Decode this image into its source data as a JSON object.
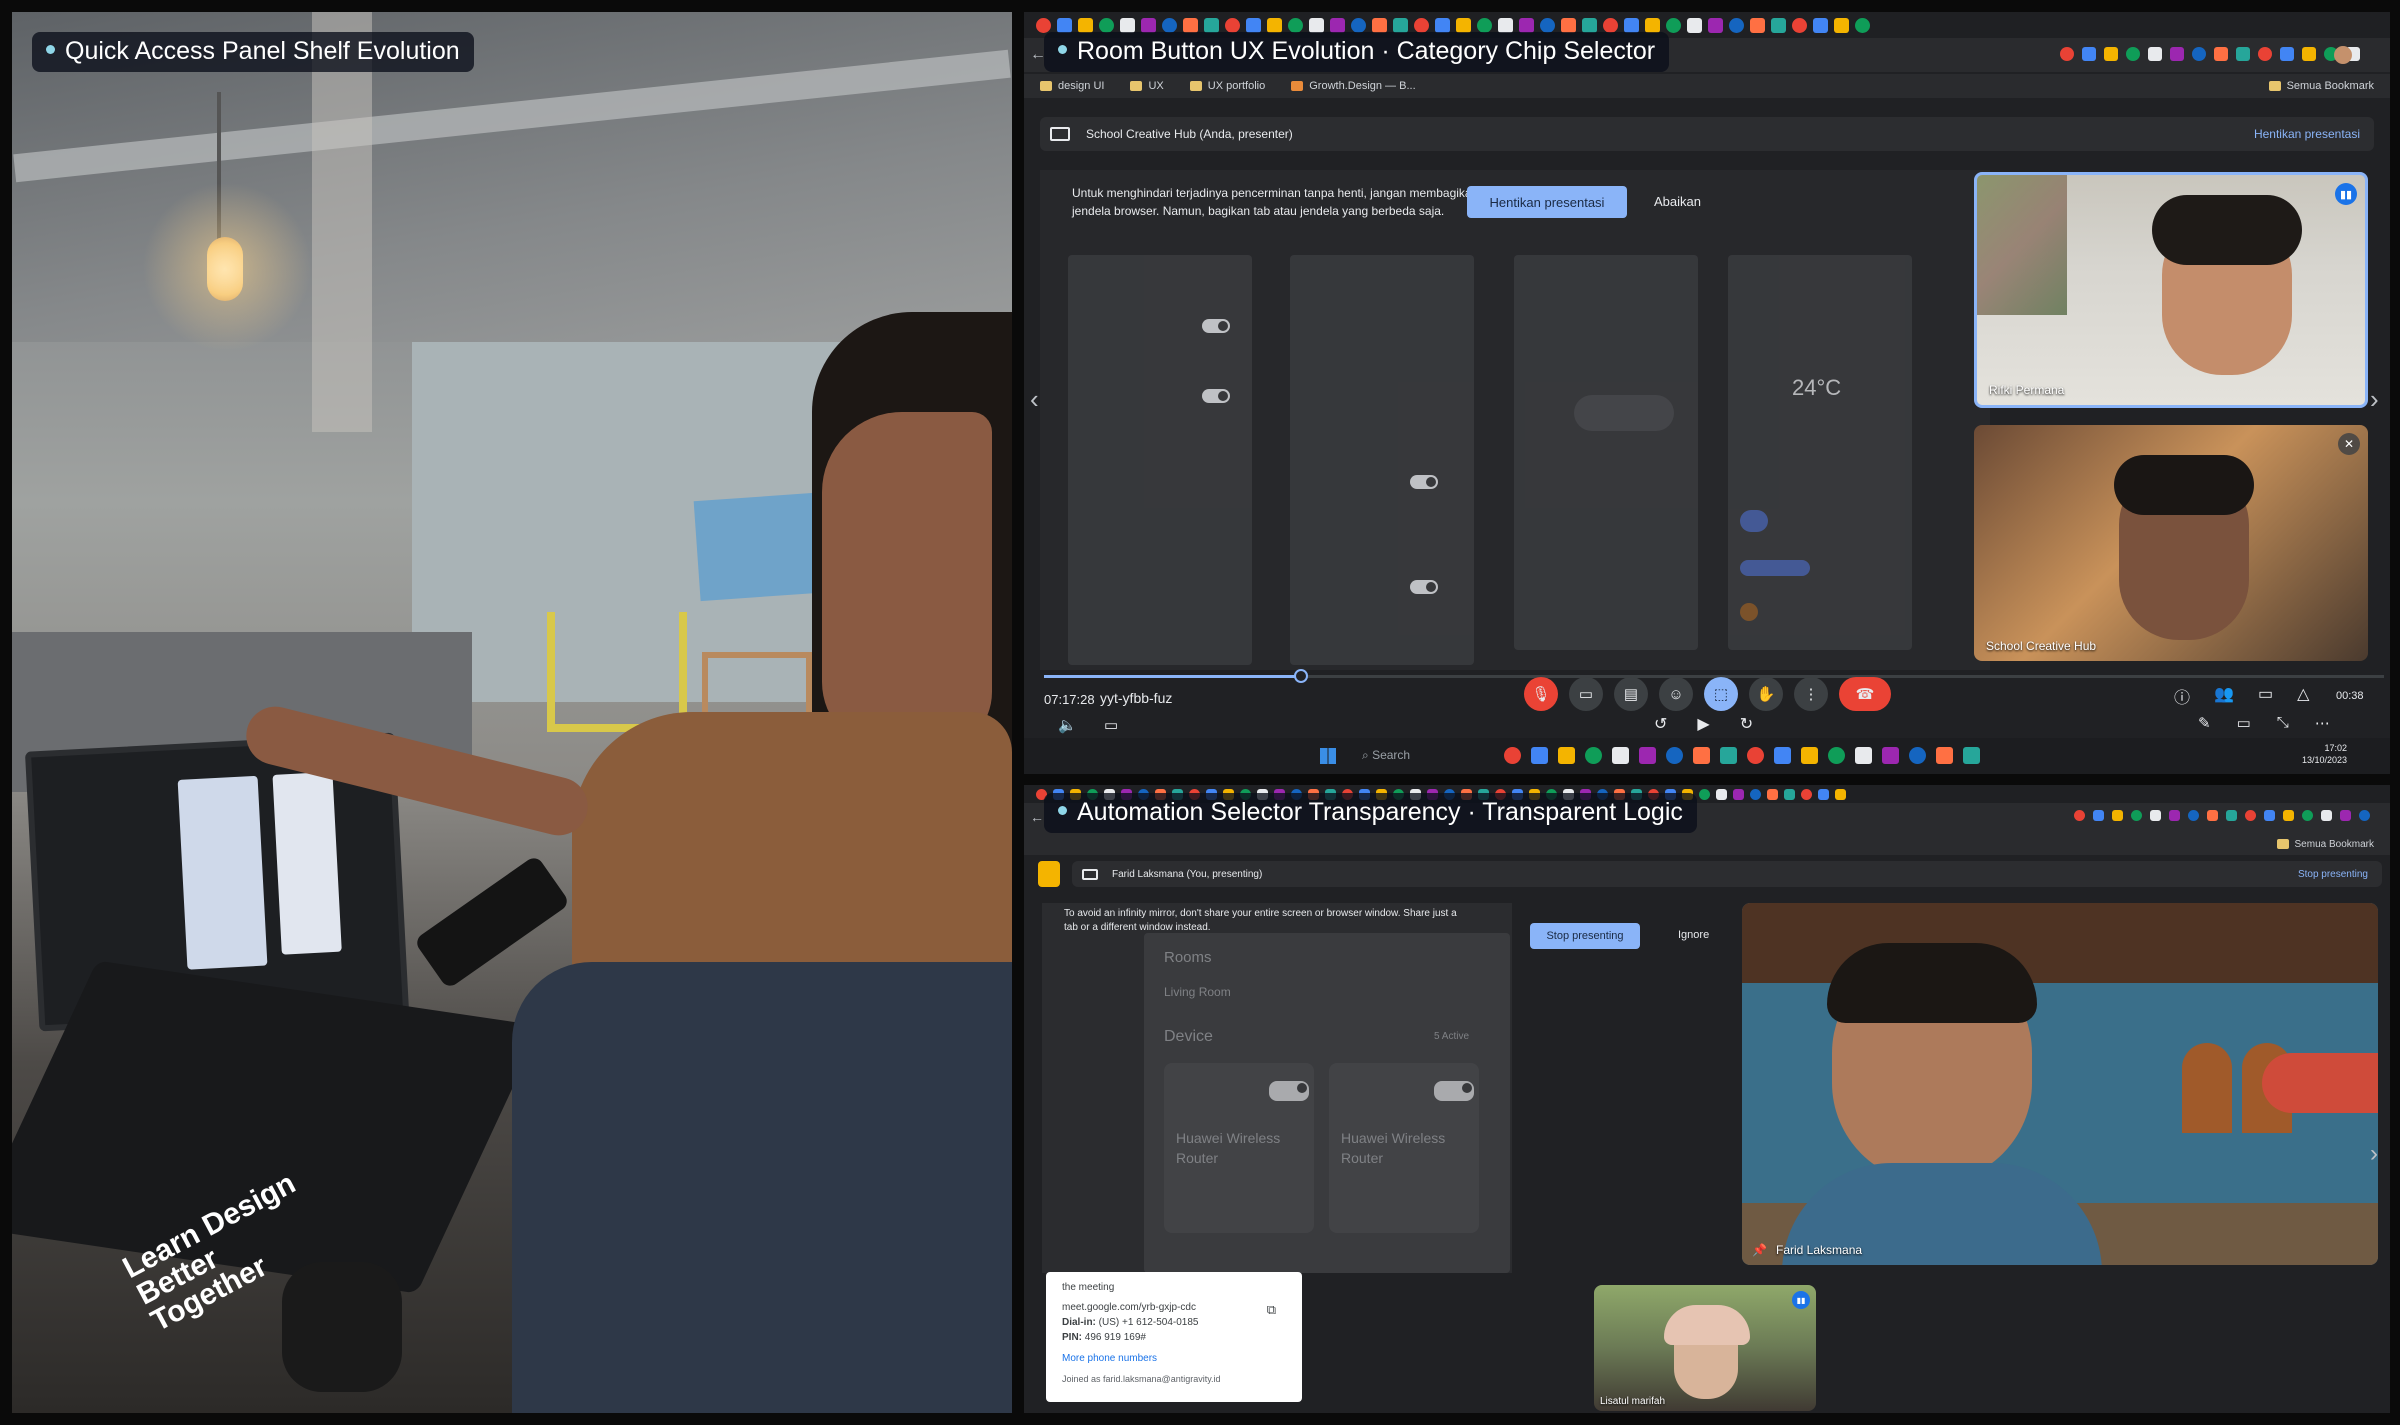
{
  "captions": {
    "left": "Quick Access Panel Shelf Evolution",
    "top_right": "Room Button UX Evolution · Category Chip Selector",
    "bottom_right": "Automation Selector Transparency · Transparent Logic"
  },
  "colors": {
    "caption_bg": "#0a0e19",
    "caption_dot": "#8fd6e8",
    "accent_blue": "#8ab4f8",
    "end_call_red": "#ea4335",
    "mic_off_red": "#ea4335"
  },
  "top_meet": {
    "bookmarks": [
      {
        "label": "design UI",
        "icon": "folder-icon"
      },
      {
        "label": "UX",
        "icon": "folder-icon"
      },
      {
        "label": "UX portfolio",
        "icon": "folder-icon"
      },
      {
        "label": "Growth.Design — B...",
        "icon": "bookmark-icon"
      }
    ],
    "all_bookmarks": "Semua Bookmark",
    "presenting_label": "School Creative Hub (Anda, presenter)",
    "stop_presenting_link": "Hentikan presentasi",
    "mirror_warning": "Untuk menghindari terjadinya pencerminan tanpa henti, jangan membagikan seluruh layar atau jendela browser. Namun, bagikan tab atau jendela yang berbeda saja.",
    "stop_button": "Hentikan presentasi",
    "dismiss_button": "Abaikan",
    "mock_temp": "24°C",
    "participants": [
      {
        "name": "Rifki Permana"
      },
      {
        "name": "School Creative Hub"
      }
    ],
    "time_code": "07:17:28",
    "meeting_code": "yyt-yfbb-fuz",
    "elapsed": "00:38",
    "taskbar_search": "Search",
    "clock_time": "17:02",
    "clock_date": "13/10/2023"
  },
  "bottom_meet": {
    "presenting_label": "Farid Laksmana (You, presenting)",
    "stop_presenting_link": "Stop presenting",
    "all_bookmarks": "Semua Bookmark",
    "mirror_warning": "To avoid an infinity mirror, don't share your entire screen or browser window. Share just a tab or a different window instead.",
    "stop_button": "Stop presenting",
    "ignore_button": "Ignore",
    "mock": {
      "rooms_title": "Rooms",
      "room_tab": "Living Room",
      "device_title": "Device",
      "active_count": "5 Active",
      "device_a": "Huawei Wireless Router",
      "device_b": "Huawei Wireless Router"
    },
    "join_card": {
      "lead": "the meeting",
      "link": "meet.google.com/yrb-gxjp-cdc",
      "dial_in_label": "Dial-in:",
      "dial_in": "(US) +1 612-504-0185",
      "pin_label": "PIN:",
      "pin": "496 919 169#",
      "more_numbers": "More phone numbers",
      "joined_as": "Joined as farid.laksmana@antigravity.id"
    },
    "participants": [
      {
        "name": "Farid Laksmana"
      },
      {
        "name": "Lisatul marifah"
      }
    ]
  },
  "photo": {
    "sticker_text": "Learn Design Better Together"
  }
}
